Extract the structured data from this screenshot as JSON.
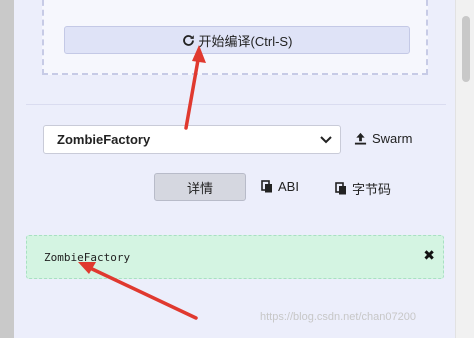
{
  "compile": {
    "button_label": "开始编译(Ctrl-S)",
    "icon": "refresh-icon"
  },
  "contract": {
    "selected": "ZombieFactory",
    "swarm_label": "Swarm",
    "details_label": "详情",
    "abi_label": "ABI",
    "bytecode_label": "字节码"
  },
  "result": {
    "text": "ZombieFactory",
    "close_symbol": "✖"
  },
  "watermark": "https://blog.csdn.net/chan07200",
  "colors": {
    "annotation_arrow": "#e0392f",
    "result_bg": "#d4f4e2"
  }
}
